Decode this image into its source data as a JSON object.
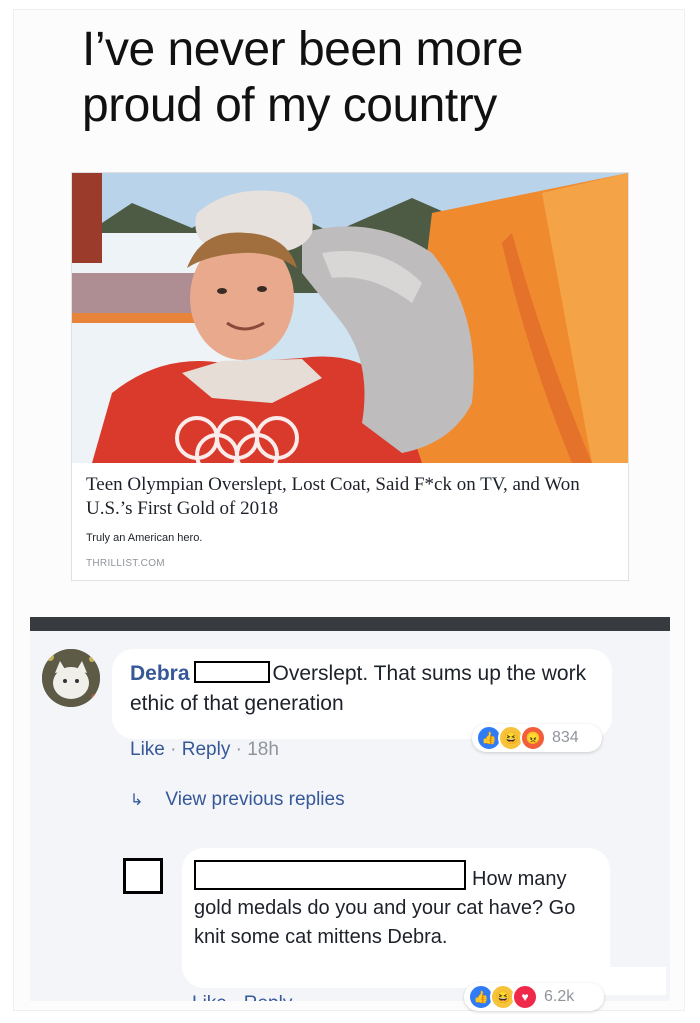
{
  "meme": {
    "headline_line1": "I’ve never been more",
    "headline_line2": "proud of my country"
  },
  "link_card": {
    "title": "Teen Olympian Overslept, Lost Coat, Said F*ck on TV, and Won U.S.’s First Gold of 2018",
    "subtitle": "Truly an American hero.",
    "source": "THRILLIST.COM"
  },
  "comment1": {
    "author": "Debra",
    "text": "Overslept. That sums up the work ethic of that generation",
    "like_label": "Like",
    "reply_label": "Reply",
    "separator": "·",
    "time": "18h",
    "reaction_count": "834",
    "reaction_icons": [
      "like-icon",
      "haha-icon",
      "angry-icon"
    ]
  },
  "replies": {
    "view_previous": "View previous replies"
  },
  "comment2": {
    "text": "How many gold medals do you and your cat have? Go knit some cat mittens Debra.",
    "reaction_count": "6.2k",
    "reaction_icons": [
      "like-icon",
      "haha-icon",
      "love-icon"
    ]
  },
  "colors": {
    "link_blue": "#365899",
    "comment_bg": "#f3f5f8",
    "divider": "#373b40"
  }
}
